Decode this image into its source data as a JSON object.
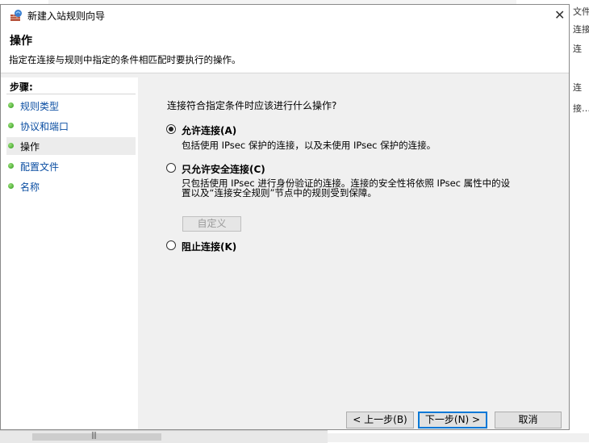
{
  "background": {
    "right_text": [
      "文件",
      "连接",
      "连",
      "连",
      "接…"
    ]
  },
  "dialog": {
    "title": "新建入站规则向导",
    "close_glyph": "✕",
    "header": {
      "title": "操作",
      "subtitle": "指定在连接与规则中指定的条件相匹配时要执行的操作。"
    },
    "sidebar": {
      "label": "步骤:",
      "items": [
        {
          "label": "规则类型"
        },
        {
          "label": "协议和端口"
        },
        {
          "label": "操作",
          "current": true
        },
        {
          "label": "配置文件"
        },
        {
          "label": "名称"
        }
      ]
    },
    "content": {
      "question": "连接符合指定条件时应该进行什么操作?",
      "options": [
        {
          "label": "允许连接(A)",
          "description": "包括使用 IPsec 保护的连接，以及未使用 IPsec 保护的连接。",
          "selected": true
        },
        {
          "label": "只允许安全连接(C)",
          "description_line1": "只包括使用 IPsec 进行身份验证的连接。连接的安全性将依照 IPsec 属性中的设",
          "description_line2": "置以及“连接安全规则”节点中的规则受到保障。",
          "selected": false
        },
        {
          "label": "阻止连接(K)",
          "selected": false
        }
      ],
      "customize_label": "自定义"
    },
    "buttons": {
      "back": "< 上一步(B)",
      "next": "下一步(N) >",
      "cancel": "取消"
    }
  }
}
